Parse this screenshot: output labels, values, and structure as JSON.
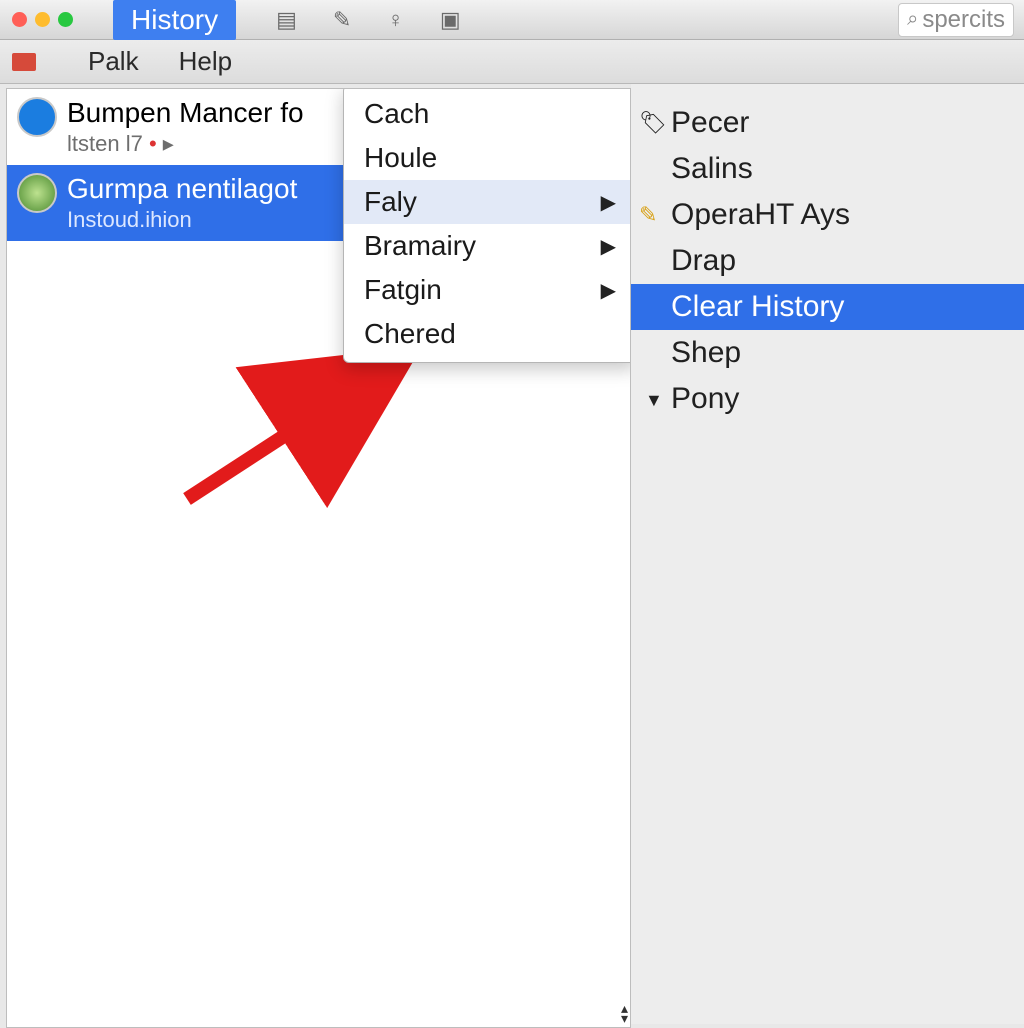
{
  "title_bar": {
    "active_menu": "History",
    "search_value": "spercits"
  },
  "menu_bar": {
    "items": [
      "Palk",
      "Help"
    ]
  },
  "history_list": [
    {
      "title": "Bumpen Mancer fo",
      "subtitle": "ltsten l7",
      "selected": false
    },
    {
      "title": "Gurmpa nentilagot",
      "subtitle": "Instoud.ihion",
      "selected": true
    }
  ],
  "dropdown": {
    "items": [
      {
        "label": "Cach",
        "submenu": false
      },
      {
        "label": "Houle",
        "submenu": false
      },
      {
        "label": "Faly",
        "submenu": true
      },
      {
        "label": "Bramairy",
        "submenu": true
      },
      {
        "label": "Fatgin",
        "submenu": true
      },
      {
        "label": "Chered",
        "submenu": false
      }
    ]
  },
  "sidebar": {
    "items": [
      {
        "label": "Pecer",
        "icon": "folder",
        "selected": false
      },
      {
        "label": "Salins",
        "icon": "",
        "selected": false
      },
      {
        "label": "OperaHT Ays",
        "icon": "pencil",
        "selected": false
      },
      {
        "label": "Drap",
        "icon": "",
        "selected": false
      },
      {
        "label": "Clear History",
        "icon": "",
        "selected": true
      },
      {
        "label": "Shep",
        "icon": "",
        "selected": false
      },
      {
        "label": "Pony",
        "icon": "disclose",
        "selected": false
      }
    ]
  }
}
